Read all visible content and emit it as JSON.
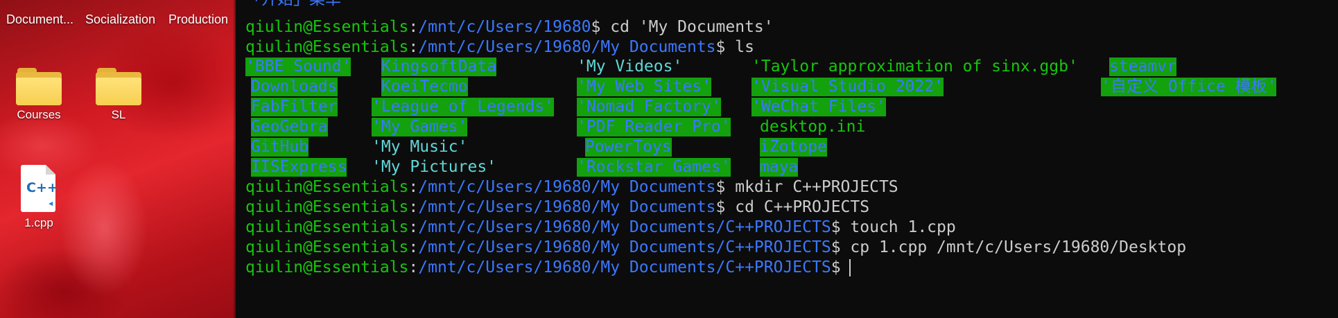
{
  "desktop": {
    "top_labels": [
      "Document...",
      "Socialization",
      "Production"
    ],
    "icons": [
      {
        "label": "Courses",
        "icon": "folder-icon"
      },
      {
        "label": "SL",
        "icon": "folder-icon"
      },
      {
        "label": "1.cpp",
        "icon": "cpp-file-icon",
        "icon_text": "C++"
      }
    ],
    "colors": {
      "wallpaper": "#d01a22",
      "folder": "#f7cf50"
    }
  },
  "terminal": {
    "partial_top": "「开始」菜单",
    "user": "qiulin@Essentials",
    "lines": [
      {
        "path": "/mnt/c/Users/19680",
        "cmd": "cd 'My Documents'"
      },
      {
        "path": "/mnt/c/Users/19680/My Documents",
        "cmd": "ls"
      }
    ],
    "ls_items": [
      "'BBE Sound'",
      "KingsoftData",
      "'My Videos'",
      "'Taylor approximation of sinx.ggb'",
      "steamvr",
      "Downloads",
      "KoeiTecmo",
      "'My Web Sites'",
      "'Visual Studio 2022'",
      "'自定义 Office 模板'",
      "FabFilter",
      "'League of Legends'",
      "'Nomad Factory'",
      "'WeChat Files'",
      "GeoGebra",
      "'My Games'",
      "'PDF Reader Pro'",
      "desktop.ini",
      "GitHub",
      "'My Music'",
      "PowerToys",
      "iZotope",
      "IISExpress",
      "'My Pictures'",
      "'Rockstar Games'",
      "maya"
    ],
    "after_lines": [
      {
        "path": "/mnt/c/Users/19680/My Documents",
        "cmd": "mkdir C++PROJECTS"
      },
      {
        "path": "/mnt/c/Users/19680/My Documents",
        "cmd": "cd C++PROJECTS"
      },
      {
        "path": "/mnt/c/Users/19680/My Documents/C++PROJECTS",
        "cmd": "touch 1.cpp"
      },
      {
        "path": "/mnt/c/Users/19680/My Documents/C++PROJECTS",
        "cmd": "cp 1.cpp /mnt/c/Users/19680/Desktop"
      },
      {
        "path": "/mnt/c/Users/19680/My Documents/C++PROJECTS",
        "cmd": ""
      }
    ],
    "colors": {
      "background": "#0c0c0c",
      "user": "#16c60c",
      "path": "#3b78ff",
      "text": "#cccccc",
      "highlight": "#13a10e",
      "quoted_dir": "#61d6d6"
    }
  }
}
